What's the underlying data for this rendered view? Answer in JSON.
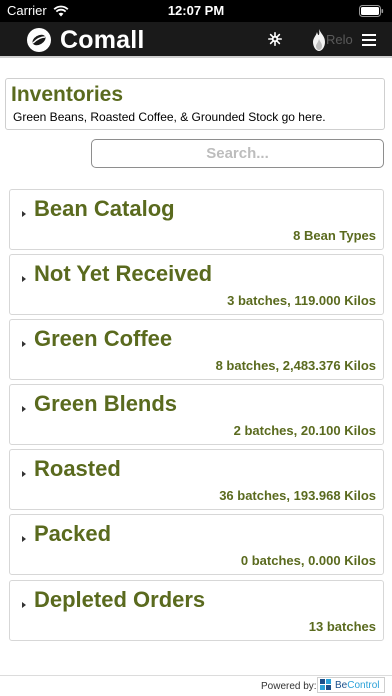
{
  "status_bar": {
    "carrier": "Carrier",
    "time": "12:07 PM"
  },
  "header": {
    "app_name": "Comall",
    "reload_label": "Relo",
    "icons": {
      "settings": "gear-icon",
      "reload": "flame-icon",
      "menu": "hamburger-menu-icon"
    }
  },
  "info": {
    "title": "Inventories",
    "subtitle": "Green Beans, Roasted Coffee, & Grounded Stock go here."
  },
  "search": {
    "placeholder": "Search...",
    "value": ""
  },
  "categories": [
    {
      "title": "Bean Catalog",
      "summary": "8 Bean Types"
    },
    {
      "title": "Not Yet Received",
      "summary": "3 batches, 119.000 Kilos"
    },
    {
      "title": "Green Coffee",
      "summary": "8 batches, 2,483.376 Kilos"
    },
    {
      "title": "Green Blends",
      "summary": "2 batches, 20.100 Kilos"
    },
    {
      "title": "Roasted",
      "summary": "36 batches, 193.968 Kilos"
    },
    {
      "title": "Packed",
      "summary": "0 batches, 0.000 Kilos"
    },
    {
      "title": "Depleted Orders",
      "summary": "13 batches"
    }
  ],
  "footer": {
    "powered_by": "Powered by:",
    "brand_part1": "Be",
    "brand_part2": "Control"
  },
  "colors": {
    "accent_olive": "#5a6a1e",
    "header_bg": "#1a1a1a",
    "status_bar_bg": "#000000"
  }
}
